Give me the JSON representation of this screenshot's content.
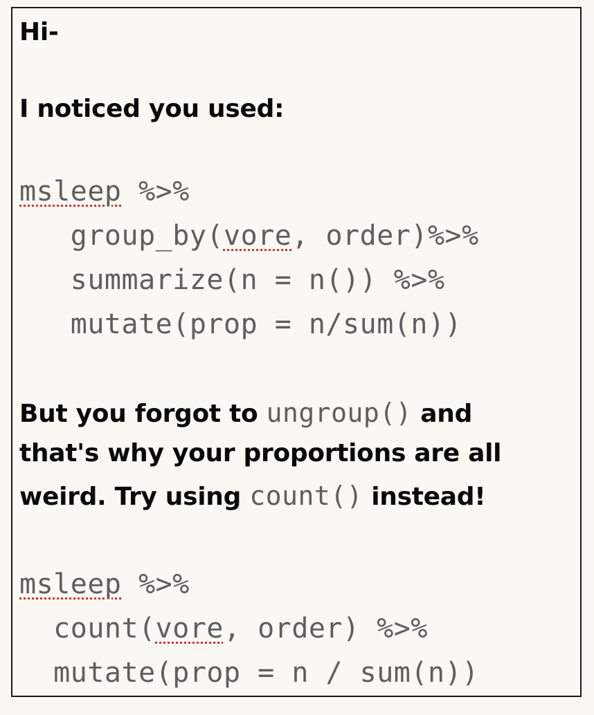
{
  "message": {
    "greeting": "Hi-",
    "intro": "I noticed you used:",
    "code_block_1": {
      "line1_word": "msleep",
      "line1_rest": " %>%",
      "line2_pre": "   group_by(",
      "line2_word": "vore",
      "line2_post": ", order)%>%",
      "line3": "   summarize(n = n()) %>%",
      "line4": "   mutate(prop = n/sum(n))"
    },
    "explanation": {
      "part1": "But you forgot to ",
      "code1": "ungroup()",
      "part2": " and",
      "line2": "that's why your proportions are all",
      "part3": "weird. Try using ",
      "code2": "count()",
      "part4": " instead!"
    },
    "code_block_2": {
      "line1_word": "msleep",
      "line1_rest": " %>%",
      "line2_pre": "  count(",
      "line2_word": "vore",
      "line2_post": ", order) %>%",
      "line3": "  mutate(prop = n / sum(n))"
    }
  }
}
